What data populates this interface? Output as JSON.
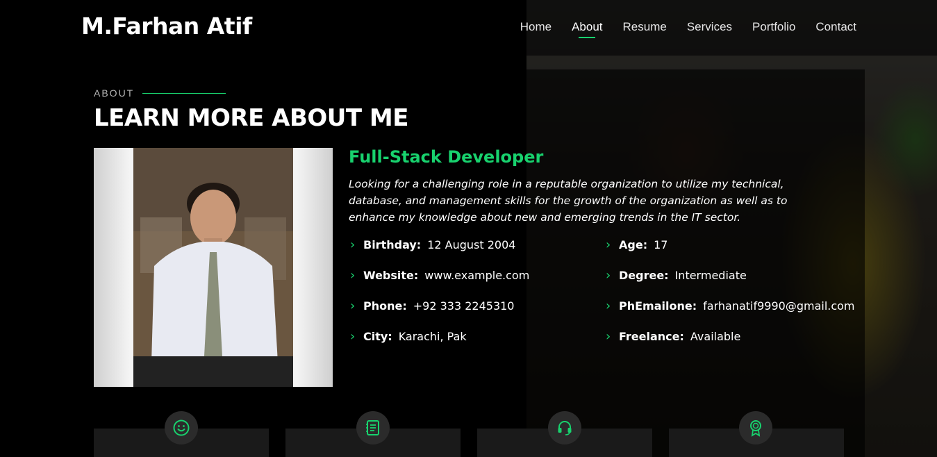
{
  "brand": {
    "name": "M.Farhan Atif"
  },
  "nav": {
    "items": [
      {
        "label": "Home"
      },
      {
        "label": "About",
        "active": true
      },
      {
        "label": "Resume"
      },
      {
        "label": "Services"
      },
      {
        "label": "Portfolio"
      },
      {
        "label": "Contact"
      }
    ]
  },
  "about": {
    "label": "ABOUT",
    "title": "LEARN MORE ABOUT ME",
    "role": "Full-Stack Developer",
    "intro": "Looking for a challenging role in a reputable organization to utilize my technical, database, and management skills for the growth of the organization as well as to enhance my knowledge about new and emerging trends in the IT sector.",
    "facts": [
      {
        "key": "Birthday:",
        "value": "12 August 2004"
      },
      {
        "key": "Age:",
        "value": "17"
      },
      {
        "key": "Website:",
        "value": "www.example.com"
      },
      {
        "key": "Degree:",
        "value": "Intermediate"
      },
      {
        "key": "Phone:",
        "value": "+92 333 2245310"
      },
      {
        "key": "PhEmailone:",
        "value": "farhanatif9990@gmail.com"
      },
      {
        "key": "City:",
        "value": "Karachi, Pak"
      },
      {
        "key": "Freelance:",
        "value": "Available"
      }
    ]
  },
  "counters": [
    {
      "icon": "smiley-icon"
    },
    {
      "icon": "journal-icon"
    },
    {
      "icon": "headset-icon"
    },
    {
      "icon": "award-icon"
    }
  ],
  "colors": {
    "accent": "#18d26e",
    "background": "#000000"
  }
}
